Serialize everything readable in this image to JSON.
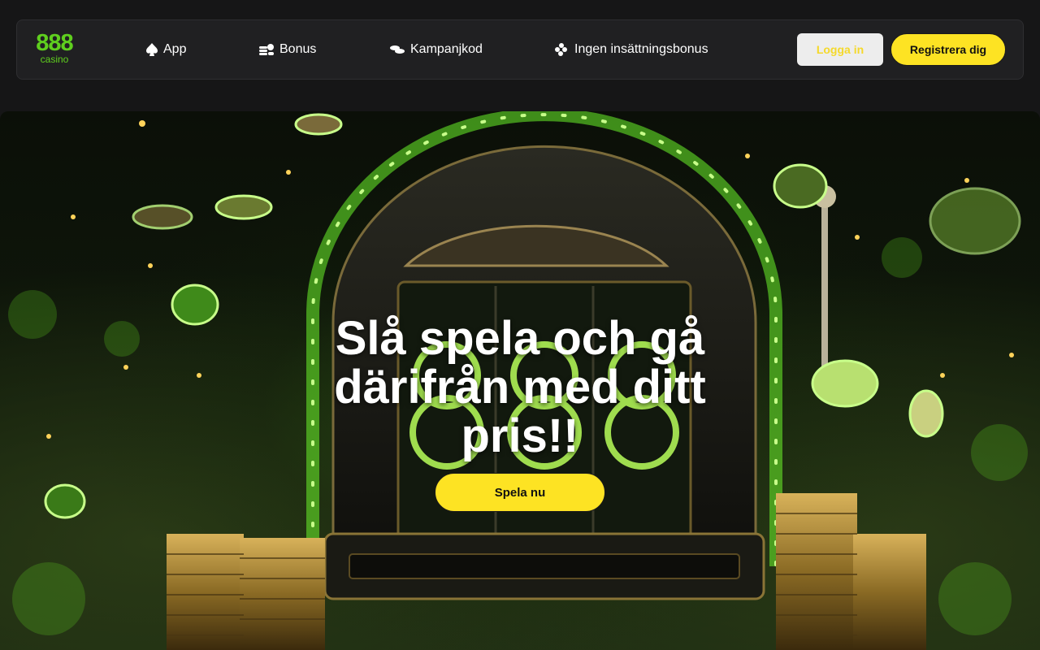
{
  "brand": {
    "logo_number": "888",
    "logo_sub": "casino",
    "accent": "#5fcf1e"
  },
  "nav": {
    "items": [
      {
        "label": "App",
        "icon": "spade-icon"
      },
      {
        "label": "Bonus",
        "icon": "coin-stack-icon"
      },
      {
        "label": "Kampanjkod",
        "icon": "chips-icon"
      },
      {
        "label": "Ingen insättningsbonus",
        "icon": "coins-cluster-icon"
      }
    ]
  },
  "auth": {
    "login_label": "Logga in",
    "register_label": "Registrera dig"
  },
  "hero": {
    "title": "Slå spela och gå därifrån med ditt pris!!",
    "cta_label": "Spela nu",
    "image": "slot-machine-with-coins-illustration"
  },
  "colors": {
    "cta": "#fde323",
    "header_bg": "#202022",
    "page_bg": "#161617"
  }
}
